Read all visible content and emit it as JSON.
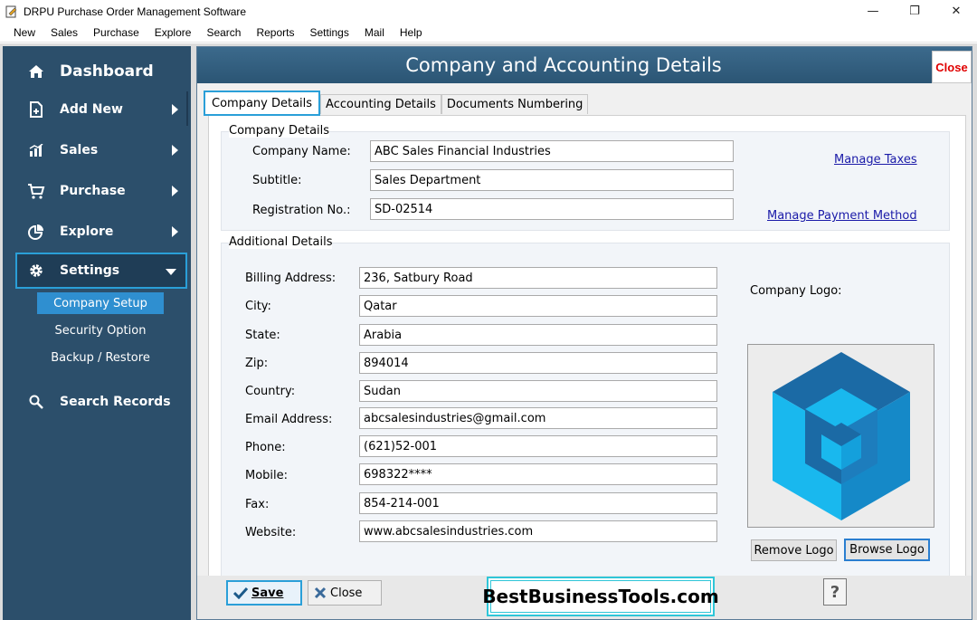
{
  "window": {
    "title": "DRPU Purchase Order Management Software",
    "controls": {
      "minimize": "—",
      "restore": "❐",
      "close": "✕"
    }
  },
  "menu": [
    "New",
    "Sales",
    "Purchase",
    "Explore",
    "Search",
    "Reports",
    "Settings",
    "Mail",
    "Help"
  ],
  "sidebar": {
    "dashboard": "Dashboard",
    "add_new": "Add New",
    "sales": "Sales",
    "purchase": "Purchase",
    "explore": "Explore",
    "settings": "Settings",
    "sub_items": [
      "Company Setup",
      "Security Option",
      "Backup / Restore"
    ],
    "search_records": "Search Records"
  },
  "header": {
    "title": "Company and Accounting Details",
    "close_label": "Close"
  },
  "tabs": [
    "Company Details",
    "Accounting Details",
    "Documents Numbering"
  ],
  "company_details": {
    "group_title": "Company Details",
    "company_name_label": "Company Name:",
    "company_name": "ABC Sales Financial Industries",
    "subtitle_label": "Subtitle:",
    "subtitle": "Sales Department",
    "registration_label": "Registration No.:",
    "registration": "SD-02514",
    "manage_taxes": "Manage Taxes",
    "manage_payment": "Manage Payment Method"
  },
  "additional_details": {
    "group_title": "Additional Details",
    "fields": [
      {
        "label": "Billing Address:",
        "value": "236, Satbury Road"
      },
      {
        "label": "City:",
        "value": "Qatar"
      },
      {
        "label": "State:",
        "value": "Arabia"
      },
      {
        "label": "Zip:",
        "value": "894014"
      },
      {
        "label": "Country:",
        "value": "Sudan"
      },
      {
        "label": "Email Address:",
        "value": "abcsalesindustries@gmail.com"
      },
      {
        "label": "Phone:",
        "value": "(621)52-001"
      },
      {
        "label": "Mobile:",
        "value": "698322****"
      },
      {
        "label": "Fax:",
        "value": "854-214-001"
      },
      {
        "label": "Website:",
        "value": "www.abcsalesindustries.com"
      }
    ],
    "logo_label": "Company Logo:",
    "remove_logo": "Remove Logo",
    "browse_logo": "Browse Logo"
  },
  "bottom": {
    "save": "Save",
    "close": "Close",
    "brand": "BestBusinessTools.com",
    "help": "?"
  },
  "colors": {
    "sidebar_bg": "#2c4f6b",
    "header_bg": "#2b5574",
    "accent_blue": "#2a9fd8",
    "close_red": "#e00000",
    "link_blue": "#1a1aa8",
    "logo_dark": "#1b6aa5",
    "logo_light": "#19b8ee"
  }
}
